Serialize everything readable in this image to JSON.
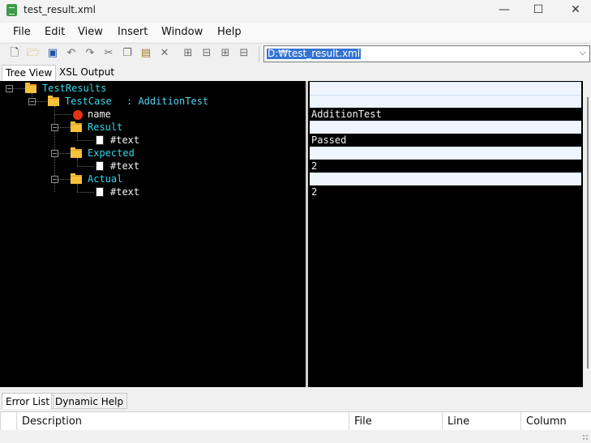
{
  "window": {
    "title": "test_result.xml",
    "minimize": "—",
    "maximize": "☐",
    "close": "✕"
  },
  "menu": [
    "File",
    "Edit",
    "View",
    "Insert",
    "Window",
    "Help"
  ],
  "toolbar": {
    "icons": [
      "new-file-icon",
      "open-folder-icon",
      "save-icon",
      "undo-icon",
      "redo-icon",
      "cut-icon",
      "copy-icon",
      "paste-icon",
      "delete-icon",
      "insert-before-icon",
      "insert-after-icon",
      "insert-child-icon",
      "insert-attribute-icon"
    ],
    "path": "D:₩test_result.xml"
  },
  "tabs": {
    "tree": "Tree View",
    "xsl": "XSL Output"
  },
  "tree": {
    "test_results": "TestResults",
    "test_case": "TestCase",
    "test_case_value": ": AdditionTest",
    "name_attr": "name",
    "result": "Result",
    "text1": "#text",
    "expected": "Expected",
    "text2": "#text",
    "actual": "Actual",
    "text3": "#text"
  },
  "values": [
    "",
    "",
    "AdditionTest",
    "",
    "Passed",
    "",
    "2",
    "",
    "2"
  ],
  "bottom": {
    "tabs": [
      "Error List",
      "Dynamic Help"
    ],
    "columns": [
      "Description",
      "File",
      "Line",
      "Column"
    ]
  },
  "colors": {
    "element": "#33d6e8",
    "background": "#000000",
    "attribute": "#e53212"
  }
}
